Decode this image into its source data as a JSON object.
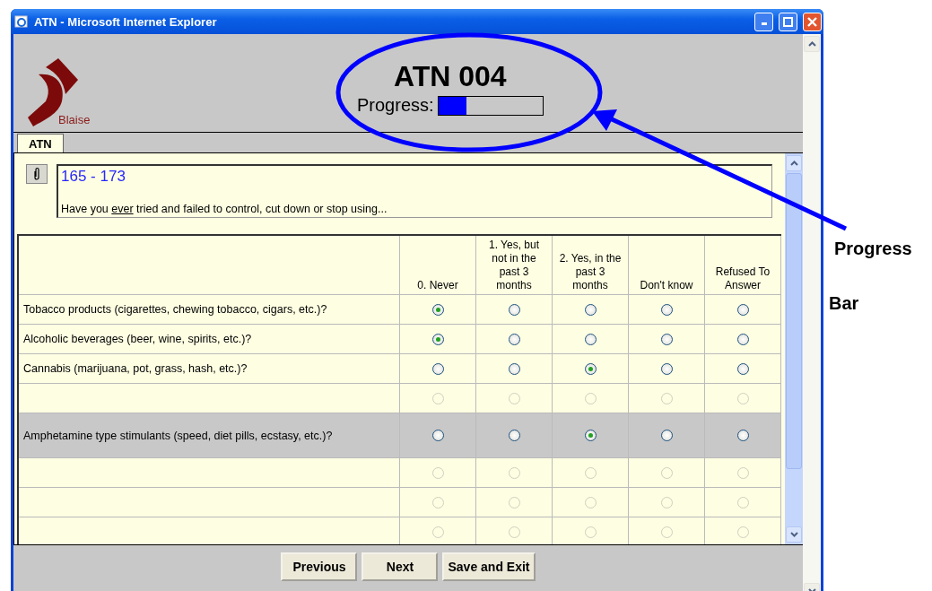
{
  "window": {
    "title": "ATN - Microsoft Internet Explorer"
  },
  "logo": {
    "text": "Blaise"
  },
  "header": {
    "title": "ATN 004",
    "progress_label": "Progress:",
    "level": 0.27
  },
  "tabs": [
    {
      "label": "ATN",
      "selected": true
    }
  ],
  "question": {
    "number": "165 - 173",
    "parts": [
      {
        "text": "Have you ",
        "underline": false
      },
      {
        "text": "ever",
        "underline": true
      },
      {
        "text": " tried and failed to control, cut down or stop using...",
        "underline": false
      }
    ]
  },
  "table": {
    "columns": [
      "0. Never",
      "1. Yes, but not in the past 3 months",
      "2. Yes, in the past 3 months",
      "Don't know",
      "Refused To Answer"
    ],
    "rows": [
      {
        "label": "Tobacco products (cigarettes, chewing tobacco, cigars, etc.)?",
        "highlighted": false,
        "enabled": true,
        "choices": [
          {
            "selected": true
          },
          {
            "selected": false
          },
          {
            "selected": false
          },
          {
            "selected": false
          },
          {
            "selected": false
          }
        ]
      },
      {
        "label": "Alcoholic beverages (beer, wine, spirits, etc.)?",
        "highlighted": false,
        "enabled": true,
        "choices": [
          {
            "selected": true
          },
          {
            "selected": false
          },
          {
            "selected": false
          },
          {
            "selected": false
          },
          {
            "selected": false
          }
        ]
      },
      {
        "label": "Cannabis (marijuana, pot, grass, hash, etc.)?",
        "highlighted": false,
        "enabled": true,
        "choices": [
          {
            "selected": false
          },
          {
            "selected": false
          },
          {
            "selected": true
          },
          {
            "selected": false
          },
          {
            "selected": false
          }
        ]
      },
      {
        "highlighted": false,
        "enabled": false,
        "choices": [
          {
            "selected": false
          },
          {
            "selected": false
          },
          {
            "selected": false
          },
          {
            "selected": false
          },
          {
            "selected": false
          }
        ]
      },
      {
        "label": "Amphetamine type stimulants (speed, diet pills, ecstasy, etc.)?",
        "highlighted": true,
        "enabled": true,
        "choices": [
          {
            "selected": false
          },
          {
            "selected": false
          },
          {
            "selected": true
          },
          {
            "selected": false
          },
          {
            "selected": false
          }
        ]
      },
      {
        "highlighted": false,
        "enabled": false,
        "choices": [
          {
            "selected": false
          },
          {
            "selected": false
          },
          {
            "selected": false
          },
          {
            "selected": false
          },
          {
            "selected": false
          }
        ]
      },
      {
        "highlighted": false,
        "enabled": false,
        "choices": [
          {
            "selected": false
          },
          {
            "selected": false
          },
          {
            "selected": false
          },
          {
            "selected": false
          },
          {
            "selected": false
          }
        ]
      },
      {
        "highlighted": false,
        "enabled": false,
        "choices": [
          {
            "selected": false
          },
          {
            "selected": false
          },
          {
            "selected": false
          },
          {
            "selected": false
          },
          {
            "selected": false
          }
        ]
      }
    ]
  },
  "buttons": [
    "Previous",
    "Next",
    "Save and Exit"
  ],
  "annotations": [
    "Progress",
    "Bar"
  ]
}
